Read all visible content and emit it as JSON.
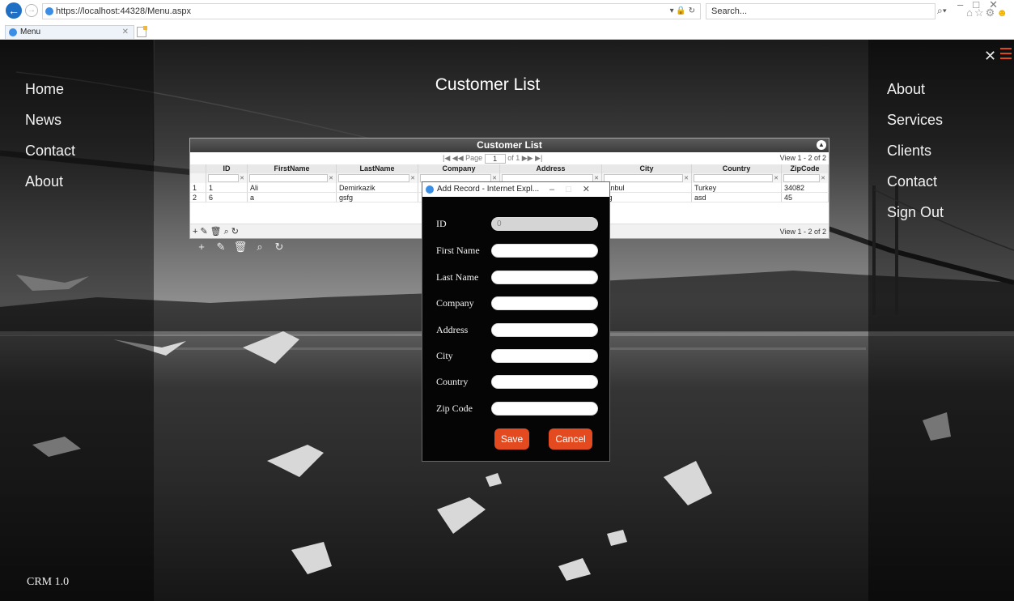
{
  "browser": {
    "address_url": "https://localhost:44328/Menu.aspx",
    "search_placeholder": "Search...",
    "tab_label": "Menu"
  },
  "left_nav": [
    "Home",
    "News",
    "Contact",
    "About"
  ],
  "right_nav": [
    "About",
    "Services",
    "Clients",
    "Contact",
    "Sign Out"
  ],
  "page_title": "Customer List",
  "footer": "CRM 1.0",
  "grid": {
    "caption": "Customer List",
    "pager": {
      "page_label": "Page",
      "page_value": "1",
      "of_label": "of 1",
      "view_text": "View 1 - 2 of 2"
    },
    "columns": [
      "ID",
      "FirstName",
      "LastName",
      "Company",
      "Address",
      "City",
      "Country",
      "ZipCode"
    ],
    "rows": [
      {
        "rn": "1",
        "id": "1",
        "first": "Ali",
        "last": "Demirkazik",
        "city": "tanbul",
        "country": "Turkey",
        "zip": "34082"
      },
      {
        "rn": "2",
        "id": "6",
        "first": "a",
        "last": "gsfg",
        "city": "sg",
        "country": "asd",
        "zip": "45"
      }
    ]
  },
  "dialog": {
    "title": "Add Record - Internet Expl...",
    "fields": [
      {
        "label": "ID",
        "value": "0"
      },
      {
        "label": "First Name",
        "value": ""
      },
      {
        "label": "Last Name",
        "value": ""
      },
      {
        "label": "Company",
        "value": ""
      },
      {
        "label": "Address",
        "value": ""
      },
      {
        "label": "City",
        "value": ""
      },
      {
        "label": "Country",
        "value": ""
      },
      {
        "label": "Zip Code",
        "value": ""
      }
    ],
    "save_label": "Save",
    "cancel_label": "Cancel"
  },
  "colors": {
    "accent": "#e34a1f",
    "sidebar_overlay": "#000000"
  }
}
